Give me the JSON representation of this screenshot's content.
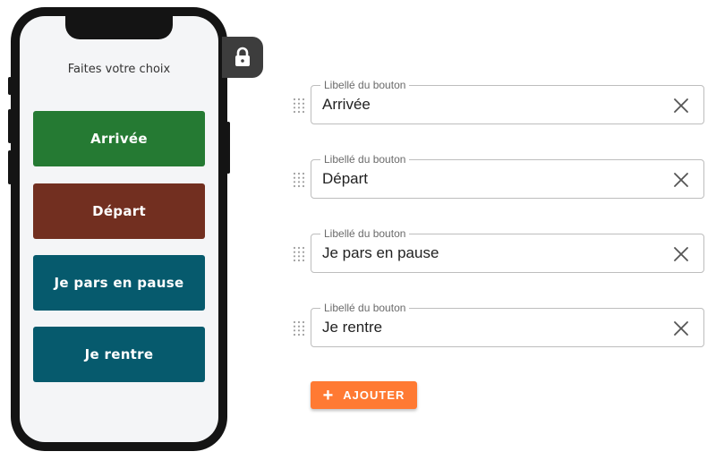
{
  "phone": {
    "title": "Faites votre choix",
    "buttons": [
      {
        "label": "Arrivée",
        "color": "#257a33"
      },
      {
        "label": "Départ",
        "color": "#722f20"
      },
      {
        "label": "Je pars en pause",
        "color": "#065a6d"
      },
      {
        "label": "Je rentre",
        "color": "#065a6d"
      }
    ]
  },
  "lock": {
    "icon": "lock-icon"
  },
  "fields": [
    {
      "label": "Libellé du bouton",
      "value": "Arrivée"
    },
    {
      "label": "Libellé du bouton",
      "value": "Départ"
    },
    {
      "label": "Libellé du bouton",
      "value": "Je pars en pause"
    },
    {
      "label": "Libellé du bouton",
      "value": "Je rentre"
    }
  ],
  "add_button": {
    "label": "AJOUTER",
    "icon": "plus-icon",
    "color": "#ff7a33"
  }
}
